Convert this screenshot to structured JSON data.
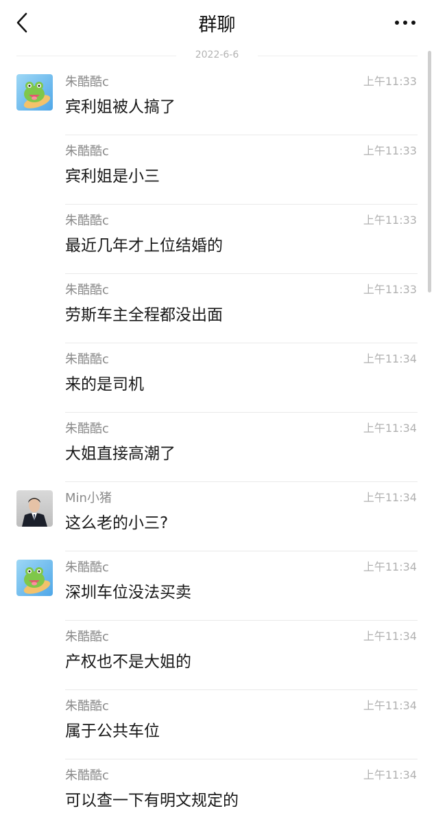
{
  "header": {
    "title": "群聊",
    "back_icon": "chevron-left-icon",
    "more_icon": "ellipsis-icon"
  },
  "date_separator": "2022-6-6",
  "colors": {
    "background": "#ffffff",
    "sender": "#8a8a8a",
    "time": "#b0b0b0",
    "text": "#181818",
    "divider": "#e9e9e9"
  },
  "messages": [
    {
      "sender": "朱酷酷c",
      "time": "上午11:33",
      "text": "宾利姐被人搞了",
      "avatar": "frog-avatar"
    },
    {
      "sender": "朱酷酷c",
      "time": "上午11:33",
      "text": "宾利姐是小三",
      "avatar": ""
    },
    {
      "sender": "朱酷酷c",
      "time": "上午11:33",
      "text": "最近几年才上位结婚的",
      "avatar": ""
    },
    {
      "sender": "朱酷酷c",
      "time": "上午11:33",
      "text": "劳斯车主全程都没出面",
      "avatar": ""
    },
    {
      "sender": "朱酷酷c",
      "time": "上午11:34",
      "text": "来的是司机",
      "avatar": ""
    },
    {
      "sender": "朱酷酷c",
      "time": "上午11:34",
      "text": "大姐直接高潮了",
      "avatar": ""
    },
    {
      "sender": "Min小猪",
      "time": "上午11:34",
      "text": "这么老的小三?",
      "avatar": "man-suit-avatar"
    },
    {
      "sender": "朱酷酷c",
      "time": "上午11:34",
      "text": "深圳车位没法买卖",
      "avatar": "frog-avatar"
    },
    {
      "sender": "朱酷酷c",
      "time": "上午11:34",
      "text": "产权也不是大姐的",
      "avatar": ""
    },
    {
      "sender": "朱酷酷c",
      "time": "上午11:34",
      "text": "属于公共车位",
      "avatar": ""
    },
    {
      "sender": "朱酷酷c",
      "time": "上午11:34",
      "text": "可以查一下有明文规定的",
      "avatar": ""
    }
  ]
}
